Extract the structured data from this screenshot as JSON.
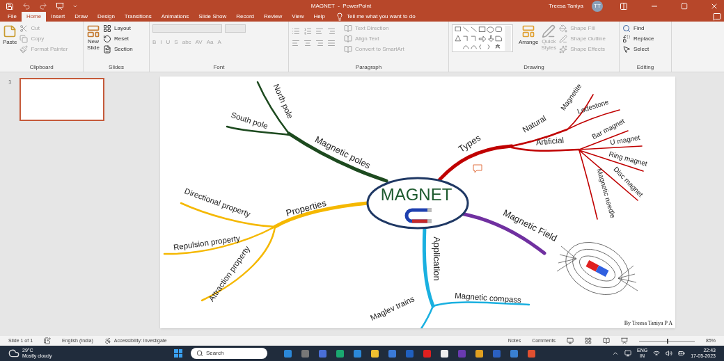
{
  "window": {
    "title": "MAGNET  -  PowerPoint",
    "user": "Treesa Taniya",
    "user_initials": "TT"
  },
  "tabs": [
    {
      "label": "File",
      "selected": false
    },
    {
      "label": "Home",
      "selected": true
    },
    {
      "label": "Insert",
      "selected": false
    },
    {
      "label": "Draw",
      "selected": false
    },
    {
      "label": "Design",
      "selected": false
    },
    {
      "label": "Transitions",
      "selected": false
    },
    {
      "label": "Animations",
      "selected": false
    },
    {
      "label": "Slide Show",
      "selected": false
    },
    {
      "label": "Record",
      "selected": false
    },
    {
      "label": "Review",
      "selected": false
    },
    {
      "label": "View",
      "selected": false
    },
    {
      "label": "Help",
      "selected": false
    }
  ],
  "tell_me": "Tell me what you want to do",
  "ribbon": {
    "clipboard": {
      "label": "Clipboard",
      "paste": "Paste",
      "items": [
        {
          "label": "Cut",
          "disabled": true
        },
        {
          "label": "Copy",
          "disabled": true
        },
        {
          "label": "Format Painter",
          "disabled": true
        }
      ]
    },
    "slides": {
      "label": "Slides",
      "new_slide": [
        "New",
        "Slide"
      ],
      "items": [
        {
          "label": "Layout",
          "disabled": false
        },
        {
          "label": "Reset",
          "disabled": false
        },
        {
          "label": "Section",
          "disabled": false
        }
      ]
    },
    "font": {
      "label": "Font",
      "format_buttons": [
        "B",
        "I",
        "U",
        "S",
        "abc",
        "AV",
        "Aa",
        "A"
      ]
    },
    "paragraph": {
      "label": "Paragraph",
      "items": [
        {
          "label": "Text Direction",
          "disabled": true
        },
        {
          "label": "Align Text",
          "disabled": true
        },
        {
          "label": "Convert to SmartArt",
          "disabled": true
        }
      ]
    },
    "drawing": {
      "label": "Drawing",
      "arrange": "Arrange",
      "quick_styles": [
        "Quick",
        "Styles"
      ],
      "items": [
        {
          "label": "Shape Fill",
          "disabled": true
        },
        {
          "label": "Shape Outline",
          "disabled": true
        },
        {
          "label": "Shape Effects",
          "disabled": true
        }
      ]
    },
    "editing": {
      "label": "Editing",
      "items": [
        {
          "label": "Find",
          "disabled": false
        },
        {
          "label": "Replace",
          "disabled": false
        },
        {
          "label": "Select",
          "disabled": false
        }
      ]
    }
  },
  "slides_pane": [
    {
      "number": "1",
      "selected": true
    }
  ],
  "slide": {
    "center": "MAGNET",
    "author": "By Treesa Taniya P A",
    "branches": [
      {
        "label": "Magnetic poles",
        "color": "#1d4a1f",
        "children": [
          {
            "label": "North pole"
          },
          {
            "label": "South pole"
          }
        ]
      },
      {
        "label": "Types",
        "color": "#c00000",
        "children": [
          {
            "label": "Natural",
            "children": [
              {
                "label": "Magnetite"
              },
              {
                "label": "Lodestone"
              }
            ]
          },
          {
            "label": "Artificial",
            "children": [
              {
                "label": "Bar magnet"
              },
              {
                "label": "U magnet"
              },
              {
                "label": "Ring magnet"
              },
              {
                "label": "Disc magnet"
              },
              {
                "label": "Magnetic needle"
              }
            ]
          }
        ]
      },
      {
        "label": "Magnetic Field",
        "color": "#7030a0"
      },
      {
        "label": "Application",
        "color": "#1ab0e0",
        "children": [
          {
            "label": "Magnetic compass"
          },
          {
            "label": "Maglev trains"
          }
        ]
      },
      {
        "label": "Properties",
        "color": "#f5b800",
        "children": [
          {
            "label": "Directional property"
          },
          {
            "label": "Repulsion property"
          },
          {
            "label": "Attraction property"
          }
        ]
      }
    ]
  },
  "status_bar": {
    "slide": "Slide 1 of 1",
    "language": "English (India)",
    "accessibility": "Accessibility: Investigate",
    "notes": "Notes",
    "comments": "Comments",
    "zoom": "85%",
    "level": 0.5
  },
  "taskbar": {
    "temperature": "29°C",
    "weather": "Mostly cloudy",
    "search": "Search",
    "language": [
      "ENG",
      "IN"
    ],
    "time": "22:43",
    "date": "17-05-2023"
  }
}
